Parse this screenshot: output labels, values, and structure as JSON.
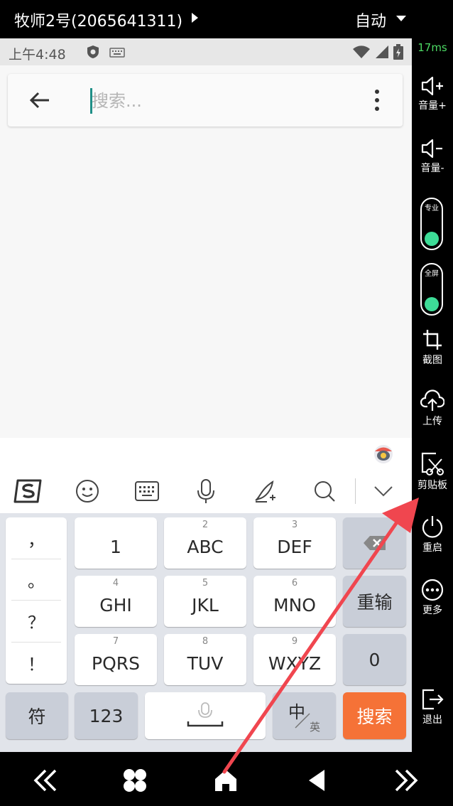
{
  "topbar": {
    "device_name": "牧师2号(2065641311)",
    "mode": "自动"
  },
  "statusbar": {
    "time": "上午4:48"
  },
  "search": {
    "placeholder": "搜索..."
  },
  "keyboard": {
    "punctuation": [
      "，",
      "。",
      "？",
      "！"
    ],
    "rows": [
      [
        {
          "sub": "",
          "label": "1"
        },
        {
          "sub": "2",
          "label": "ABC"
        },
        {
          "sub": "3",
          "label": "DEF"
        }
      ],
      [
        {
          "sub": "4",
          "label": "GHI"
        },
        {
          "sub": "5",
          "label": "JKL"
        },
        {
          "sub": "6",
          "label": "MNO"
        }
      ],
      [
        {
          "sub": "7",
          "label": "PQRS"
        },
        {
          "sub": "8",
          "label": "TUV"
        },
        {
          "sub": "9",
          "label": "WXYZ"
        }
      ]
    ],
    "reenter": "重输",
    "zero": "0",
    "symbols": "符",
    "numbers": "123",
    "lang_main": "中",
    "lang_sub": "英",
    "search_key": "搜索",
    "search_key_color": "#f57237"
  },
  "sidebar": {
    "latency": "17ms",
    "volume_up": "音量+",
    "volume_down": "音量-",
    "toggle_pro": "专业",
    "toggle_full": "全屏",
    "toggle_color": "#3ddc97",
    "screenshot": "截图",
    "upload": "上传",
    "clipboard": "剪贴板",
    "restart": "重启",
    "more": "更多",
    "exit": "退出"
  },
  "annotation": {
    "arrow_color": "#f0464f"
  }
}
